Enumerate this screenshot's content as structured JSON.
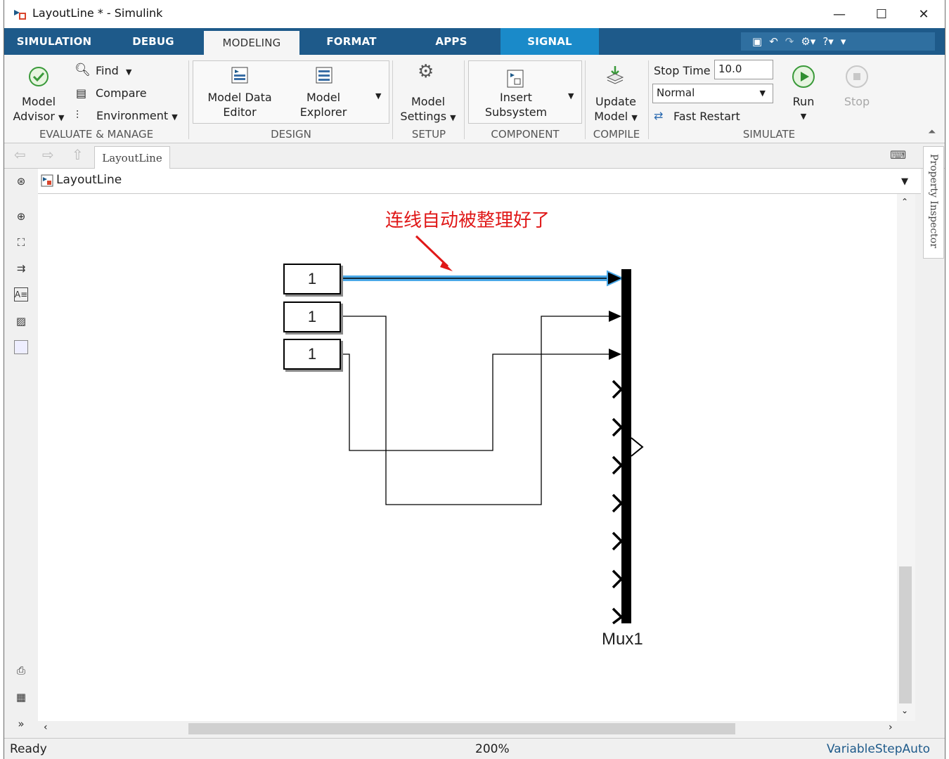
{
  "window": {
    "title": "LayoutLine * - Simulink",
    "minimize": "—",
    "maximize": "☐",
    "close": "✕"
  },
  "tabs": [
    {
      "label": "SIMULATION"
    },
    {
      "label": "DEBUG"
    },
    {
      "label": "MODELING"
    },
    {
      "label": "FORMAT"
    },
    {
      "label": "APPS"
    },
    {
      "label": "SIGNAL"
    }
  ],
  "ribbon": {
    "model_advisor": [
      "Model",
      "Advisor"
    ],
    "find": "Find",
    "compare": "Compare",
    "environment": "Environment",
    "evaluate_manage": "EVALUATE & MANAGE",
    "model_data_editor": [
      "Model Data",
      "Editor"
    ],
    "model_explorer": [
      "Model",
      "Explorer"
    ],
    "design": "DESIGN",
    "model_settings": [
      "Model",
      "Settings"
    ],
    "setup": "SETUP",
    "insert_subsystem": [
      "Insert",
      "Subsystem"
    ],
    "component": "COMPONENT",
    "update_model": [
      "Update",
      "Model"
    ],
    "compile": "COMPILE",
    "stop_time_label": "Stop Time",
    "stop_time_value": "10.0",
    "sim_mode": "Normal",
    "fast_restart": "Fast Restart",
    "run": "Run",
    "stop": "Stop",
    "simulate": "SIMULATE"
  },
  "nav": {
    "breadcrumb": "LayoutLine"
  },
  "address": {
    "model_name": "LayoutLine"
  },
  "property_inspector": "Property Inspector",
  "canvas": {
    "annotation": "连线自动被整理好了",
    "constants": [
      "1",
      "1",
      "1"
    ],
    "mux_label": "Mux1"
  },
  "status": {
    "ready": "Ready",
    "zoom": "200%",
    "solver": "VariableStepAuto"
  },
  "colors": {
    "tabbar": "#1e5a8a",
    "signal_tab": "#1a8ac9",
    "highlight_line": "#4aa8e8",
    "annotation": "#e01818"
  }
}
